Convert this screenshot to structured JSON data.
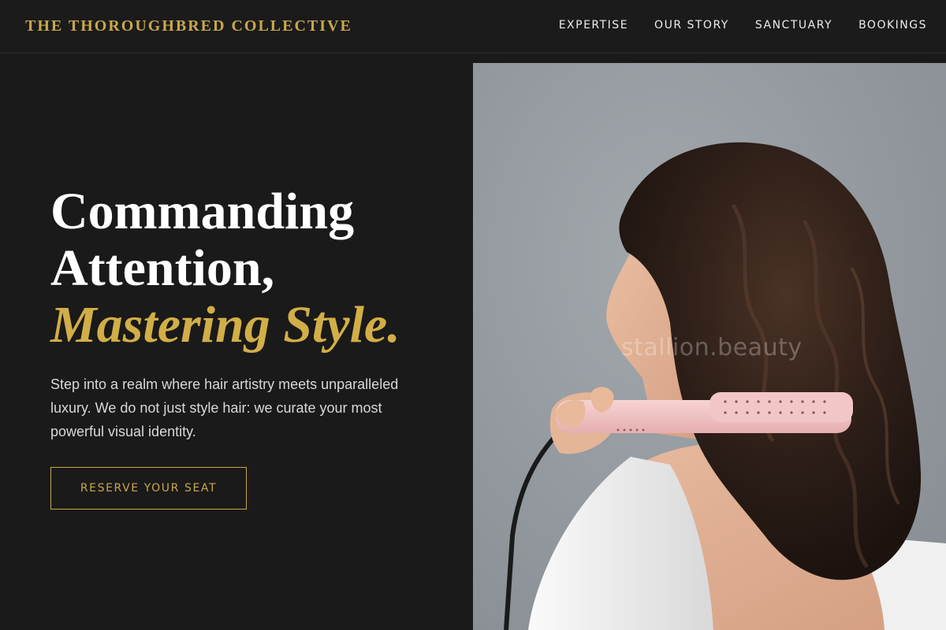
{
  "header": {
    "brand": "THE THOROUGHBRED COLLECTIVE",
    "nav": [
      {
        "label": "EXPERTISE"
      },
      {
        "label": "OUR STORY"
      },
      {
        "label": "SANCTUARY"
      },
      {
        "label": "BOOKINGS"
      }
    ]
  },
  "hero": {
    "headline_line1": "Commanding",
    "headline_line2": "Attention,",
    "headline_accent": "Mastering Style.",
    "intro": "Step into a realm where hair artistry meets unparalleled luxury. We do not just style hair: we curate your most powerful visual identity.",
    "cta_label": "RESERVE YOUR SEAT",
    "image": {
      "watermark": "stallion.beauty"
    }
  },
  "colors": {
    "background": "#1a1a1a",
    "accent_gold": "#c9a74a",
    "text_light": "#ffffff"
  }
}
